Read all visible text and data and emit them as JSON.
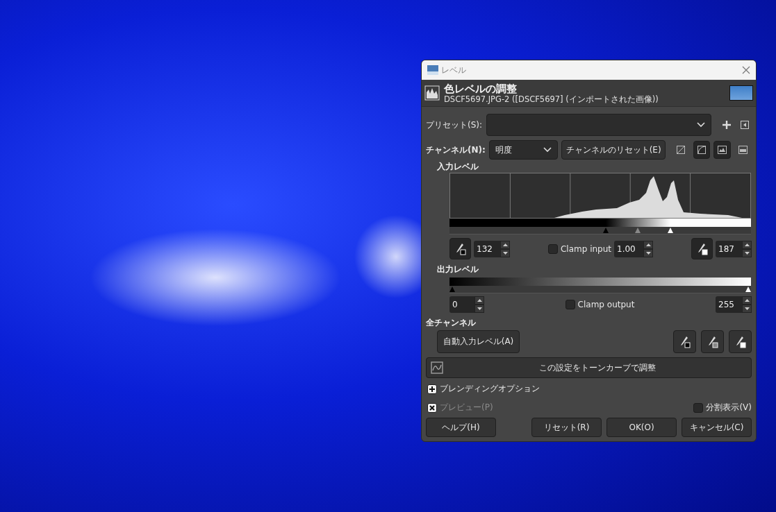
{
  "window": {
    "title": "レベル"
  },
  "header": {
    "title": "色レベルの調整",
    "subtitle": "DSCF5697.JPG-2 ([DSCF5697] (インポートされた画像))"
  },
  "preset": {
    "label": "プリセット(S):"
  },
  "channel": {
    "label": "チャンネル(N):",
    "value": "明度",
    "reset": "チャンネルのリセット(E)",
    "scale_buttons": [
      {
        "selected": false
      },
      {
        "selected": true
      }
    ],
    "histogram_buttons": [
      {
        "selected": true
      },
      {
        "selected": false
      }
    ]
  },
  "input_levels": {
    "title": "入力レベル",
    "handles": [
      {
        "level": 0.518
      },
      {
        "level": 0.624
      },
      {
        "level": 0.733
      }
    ],
    "low": "132",
    "clamp": {
      "label": "Clamp input",
      "checked": false
    },
    "gamma": "1.00",
    "high": "187"
  },
  "output_levels": {
    "title": "出力レベル",
    "handles": [
      {
        "level": 0
      },
      {
        "level": 1
      }
    ],
    "low": "0",
    "clamp": {
      "label": "Clamp output",
      "checked": false
    },
    "high": "255"
  },
  "all_channels": {
    "title": "全チャンネル",
    "auto": "自動入力レベル(A)"
  },
  "curves_button": "この設定をトーンカーブで調整",
  "blending": {
    "label": "ブレンディングオプション",
    "expanded": false
  },
  "preview": {
    "label": "プレビュー(P)",
    "checked": true,
    "disabled": true
  },
  "split_view": {
    "label": "分割表示(V)",
    "checked": false
  },
  "buttons": [
    "ヘルプ(H)",
    "リセット(R)",
    "OK(O)",
    "キャンセル(C)"
  ]
}
